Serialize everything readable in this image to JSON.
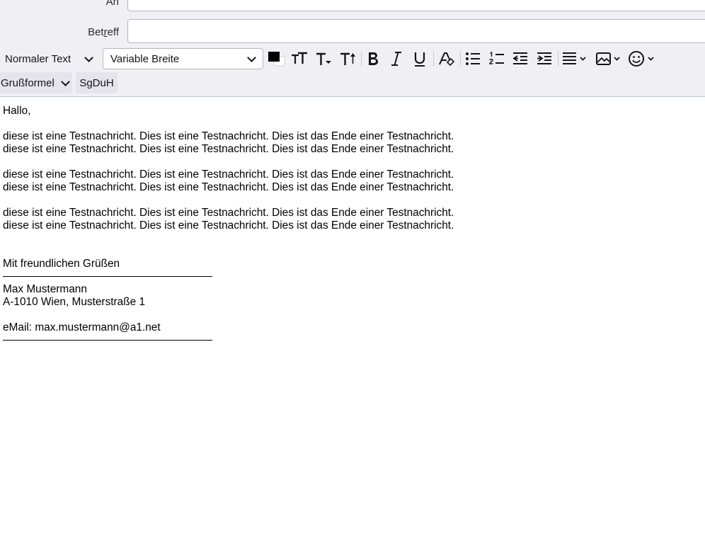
{
  "header": {
    "to_label": "An",
    "to_value": "",
    "subject_label_pre": "Bet",
    "subject_label_ul": "r",
    "subject_label_post": "eff",
    "subject_value": ""
  },
  "toolbar": {
    "paragraph_format": "Normaler Text",
    "font_face": "Variable Breite",
    "text_color": "#000000",
    "background_color": "#ffffff",
    "icons": [
      "text-color-icon",
      "font-size-smaller-icon",
      "font-size-smaller-arrow-icon",
      "font-size-larger-icon",
      "bold-icon",
      "italic-icon",
      "underline-icon",
      "remove-formatting-icon",
      "bullet-list-icon",
      "numbered-list-icon",
      "outdent-icon",
      "indent-icon",
      "align-icon",
      "insert-image-icon",
      "emoji-icon"
    ]
  },
  "templates": {
    "greeting_label": "Grußformel",
    "sgduh_label": "SgDuH"
  },
  "message": {
    "greeting": "Hallo,",
    "paragraphs": [
      [
        "diese ist eine Testnachricht. Dies ist eine Testnachricht. Dies ist das Ende einer Testnachricht.",
        "diese ist eine Testnachricht. Dies ist eine Testnachricht. Dies ist das Ende einer Testnachricht."
      ],
      [
        "diese ist eine Testnachricht. Dies ist eine Testnachricht. Dies ist das Ende einer Testnachricht.",
        "diese ist eine Testnachricht. Dies ist eine Testnachricht. Dies ist das Ende einer Testnachricht."
      ],
      [
        "diese ist eine Testnachricht. Dies ist eine Testnachricht. Dies ist das Ende einer Testnachricht.",
        "diese ist eine Testnachricht. Dies ist eine Testnachricht. Dies ist das Ende einer Testnachricht."
      ]
    ],
    "closing": "Mit freundlichen Grüßen",
    "signature": {
      "name": "Max Mustermann",
      "address": "A-1010 Wien, Musterstraße 1",
      "email": "eMail: max.mustermann@a1.net"
    }
  }
}
